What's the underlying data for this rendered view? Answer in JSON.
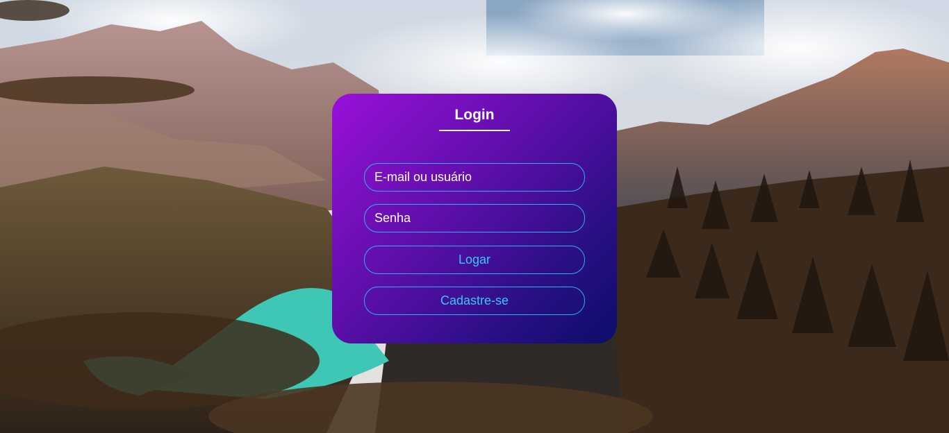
{
  "login": {
    "title": "Login",
    "email_placeholder": "E-mail ou usuário",
    "password_placeholder": "Senha",
    "login_button": "Logar",
    "register_button": "Cadastre-se"
  },
  "colors": {
    "card_gradient_start": "#9a10da",
    "card_gradient_end": "#0c0e68",
    "field_border": "#2bb3f0",
    "button_text": "#38c8f5",
    "title_text": "#ffffff",
    "lake": "#3fc7b5"
  }
}
